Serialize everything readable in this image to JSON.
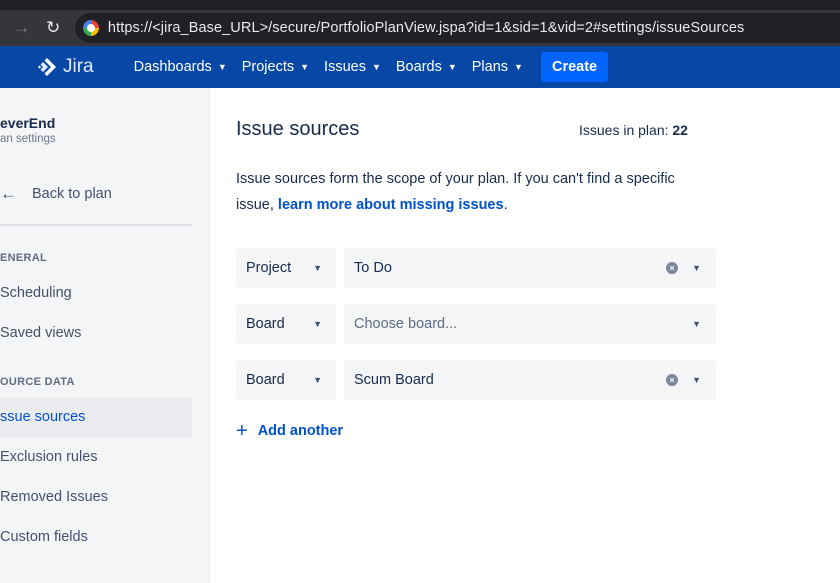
{
  "browser": {
    "url": "https://<jira_Base_URL>/secure/PortfolioPlanView.jspa?id=1&sid=1&vid=2#settings/issueSources"
  },
  "topnav": {
    "logo_text": "Jira",
    "items": [
      {
        "label": "Dashboards"
      },
      {
        "label": "Projects"
      },
      {
        "label": "Issues"
      },
      {
        "label": "Boards"
      },
      {
        "label": "Plans"
      }
    ],
    "create_label": "Create"
  },
  "sidebar": {
    "plan_name": "everEnd",
    "plan_subtitle": "an settings",
    "back_label": "Back to plan",
    "general_heading": "ENERAL",
    "general_items": [
      {
        "label": "Scheduling"
      },
      {
        "label": "Saved views"
      }
    ],
    "source_heading": "OURCE DATA",
    "source_items": [
      {
        "label": "ssue sources",
        "active": true
      },
      {
        "label": "Exclusion rules"
      },
      {
        "label": "Removed Issues"
      },
      {
        "label": "Custom fields"
      }
    ]
  },
  "main": {
    "title": "Issue sources",
    "count_label": "Issues in plan:",
    "count_value": "22",
    "description_text": "Issue sources form the scope of your plan. If you can't find a specific issue,",
    "description_link": "learn more about missing issues",
    "description_end": ".",
    "sources": [
      {
        "type": "Project",
        "value": "To Do",
        "clearable": true
      },
      {
        "type": "Board",
        "value": "Choose board...",
        "placeholder": true,
        "clearable": false
      },
      {
        "type": "Board",
        "value": "Scum Board",
        "clearable": true
      }
    ],
    "add_label": "Add another"
  },
  "colors": {
    "nav_bg": "#0747a6",
    "create_bg": "#0065ff",
    "link": "#0052cc",
    "sidebar_bg": "#f4f5f7"
  }
}
